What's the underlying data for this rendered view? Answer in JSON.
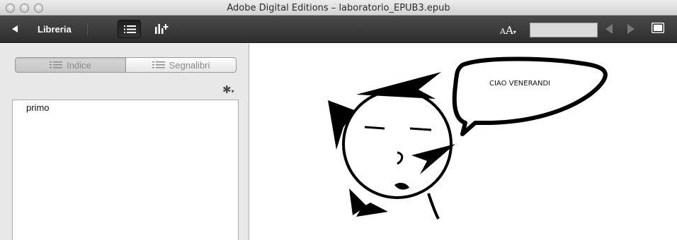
{
  "window": {
    "title": "Adobe Digital Editions – laboratorio_EPUB3.epub"
  },
  "toolbar": {
    "back_label": "Libreria",
    "font_size_label_big": "A",
    "font_size_label_small": "A",
    "page_input_value": "",
    "icons": [
      "back-icon",
      "list-view-icon",
      "stats-view-icon",
      "font-size-icon",
      "prev-page-icon",
      "next-page-icon",
      "fullscreen-icon"
    ]
  },
  "sidebar": {
    "tabs": [
      {
        "label": "Indice",
        "icon": "list-icon",
        "active": true
      },
      {
        "label": "Segnalibri",
        "icon": "bookmarks-icon",
        "active": false
      }
    ],
    "toc_items": [
      {
        "label": "primo"
      }
    ]
  },
  "content": {
    "speech_text": "CIAO VENERANDI"
  }
}
